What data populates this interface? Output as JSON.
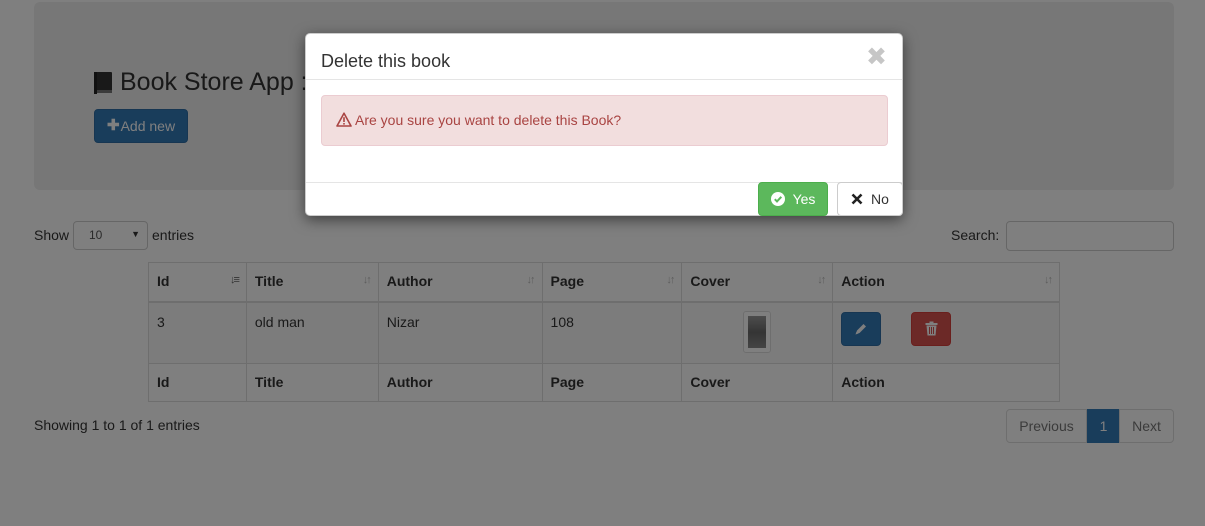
{
  "header": {
    "app_title": "Book Store App :",
    "add_button_label": "Add new"
  },
  "table_controls": {
    "show_label": "Show",
    "page_length": "10",
    "entries_label": "entries",
    "search_label": "Search:",
    "search_value": ""
  },
  "table": {
    "columns": [
      "Id",
      "Title",
      "Author",
      "Page",
      "Cover",
      "Action"
    ],
    "rows": [
      {
        "id": "3",
        "title": "old man",
        "author": "Nizar",
        "page": "108"
      }
    ],
    "sorted_column": "Id"
  },
  "footer": {
    "info": "Showing 1 to 1 of 1 entries",
    "pagination": {
      "previous": "Previous",
      "current": "1",
      "next": "Next"
    }
  },
  "modal": {
    "title": "Delete this book",
    "close_symbol": "✖",
    "message": "Are you sure you want to delete this Book?",
    "yes_label": "Yes",
    "no_label": "No"
  },
  "colors": {
    "primary": "#337ab7",
    "danger": "#d9534f",
    "success": "#5cb85c",
    "alert_bg": "#f2dede",
    "alert_text": "#a94442"
  }
}
